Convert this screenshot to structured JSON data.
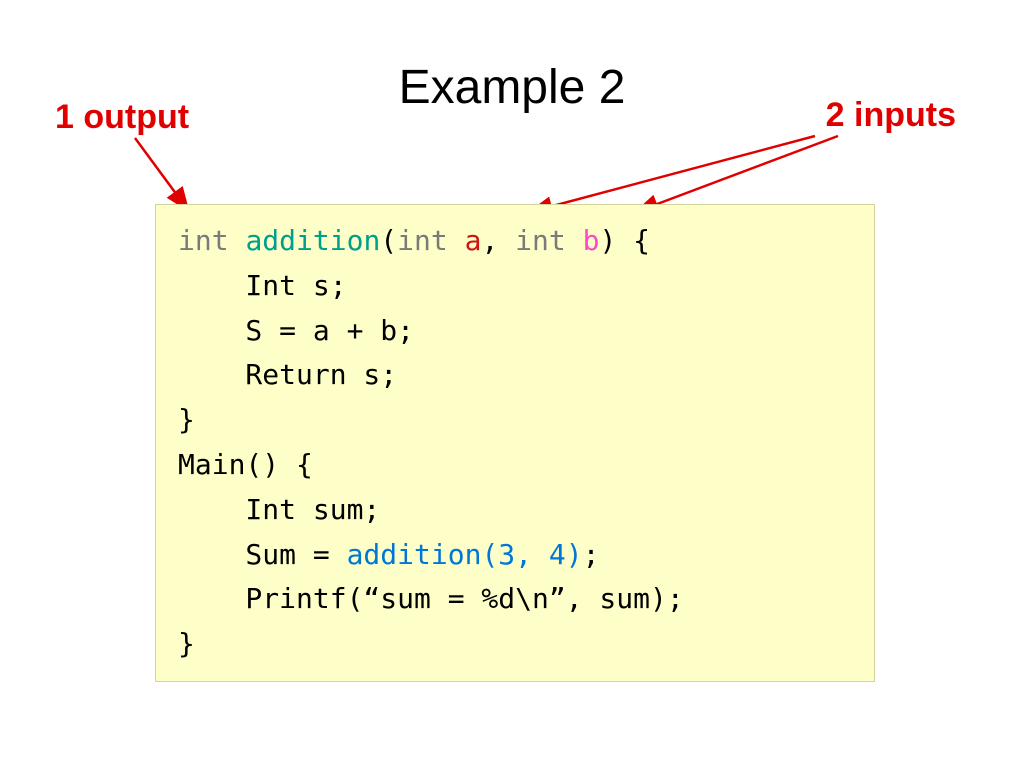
{
  "title": "Example 2",
  "labels": {
    "output": "1 output",
    "inputs": "2 inputs"
  },
  "code": {
    "int": "int",
    "addition": "addition",
    "lparen": "(",
    "int2": "int",
    "a": "a",
    "comma": ", ",
    "int3": "int",
    "b": "b",
    "rblock": ") {",
    "l2": "    Int s;",
    "l3": "    S = a + b;",
    "l4": "    Return s;",
    "l5": "}",
    "l6": "Main() {",
    "l7": "    Int sum;",
    "l8a": "    Sum = ",
    "addcall": "addition(3, 4)",
    "l8b": ";",
    "l9": "    Printf(“sum = %d\\n”, sum);",
    "l10": "}"
  },
  "colors": {
    "accent_red": "#e00000",
    "code_bg": "#feffc8"
  }
}
